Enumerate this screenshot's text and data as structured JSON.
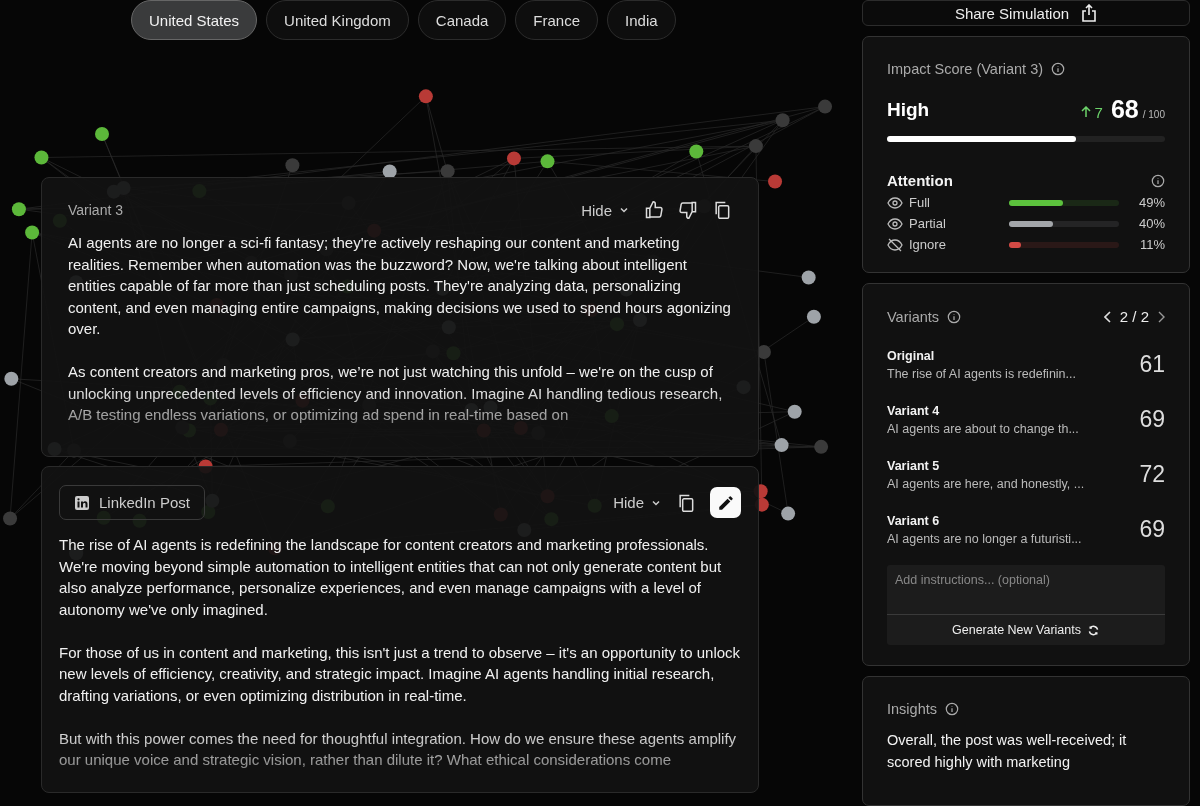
{
  "country_tabs": [
    {
      "label": "United States",
      "selected": true
    },
    {
      "label": "United Kingdom",
      "selected": false
    },
    {
      "label": "Canada",
      "selected": false
    },
    {
      "label": "France",
      "selected": false
    },
    {
      "label": "India",
      "selected": false
    }
  ],
  "variant_card": {
    "title": "Variant 3",
    "hide_label": "Hide",
    "paragraphs": [
      "AI agents are no longer a sci-fi fantasy; they're actively reshaping our content and marketing realities. Remember when automation was the buzzword? Now, we're talking about intelligent entities capable of far more than just scheduling posts. They're analyzing data, personalizing content, and even managing entire campaigns, making decisions we used to spend hours agonizing over.",
      "As content creators and marketing pros, we’re not just watching this unfold – we're on the cusp of unlocking unprecedented levels of efficiency and innovation. Imagine AI handling tedious research, A/B testing endless variations, or optimizing ad spend in real-time based on"
    ]
  },
  "post_card": {
    "platform": "LinkedIn Post",
    "hide_label": "Hide",
    "paragraphs": [
      "The rise of AI agents is redefining the landscape for content creators and marketing professionals. We're moving beyond simple automation to intelligent entities that can not only generate content but also analyze performance, personalize experiences, and even manage campaigns with a level of autonomy we've only imagined.",
      "For those of us in content and marketing, this isn't just a trend to observe – it's an opportunity to unlock new levels of efficiency, creativity, and strategic impact. Imagine AI agents handling initial research, drafting variations, or even optimizing distribution in real-time.",
      "But with this power comes the need for thoughtful integration. How do we ensure these agents amplify our unique voice and strategic vision, rather than dilute it? What ethical considerations come"
    ]
  },
  "share_button": {
    "label": "Share Simulation"
  },
  "impact": {
    "title": "Impact Score (Variant 3)",
    "rating": "High",
    "change": "7",
    "score": "68",
    "max": "/ 100",
    "level": 0.68,
    "attention_title": "Attention",
    "attention": [
      {
        "kind": "seen",
        "label": "Full",
        "reading": "49%",
        "level": 0.49,
        "color": "#5cc23d"
      },
      {
        "kind": "seen",
        "label": "Partial",
        "reading": "40%",
        "level": 0.4,
        "color": "#a3a6aa"
      },
      {
        "kind": "ignored",
        "label": "Ignore",
        "reading": "11%",
        "level": 0.11,
        "color": "#d24a45"
      }
    ]
  },
  "variants": {
    "title": "Variants",
    "pager": "2 / 2",
    "items": [
      {
        "name": "Original",
        "preview": "The rise of AI agents is redefinin...",
        "score": "61"
      },
      {
        "name": "Variant 4",
        "preview": "AI agents are about to change th...",
        "score": "69"
      },
      {
        "name": "Variant 5",
        "preview": "AI agents are here, and honestly, ...",
        "score": "72"
      },
      {
        "name": "Variant 6",
        "preview": "AI agents are no longer a futuristi...",
        "score": "69"
      }
    ],
    "instructions_placeholder": "Add instructions... (optional)",
    "generate_label": "Generate New Variants"
  },
  "insights": {
    "title": "Insights",
    "text": "Overall, the post was well-received; it scored highly with marketing"
  }
}
